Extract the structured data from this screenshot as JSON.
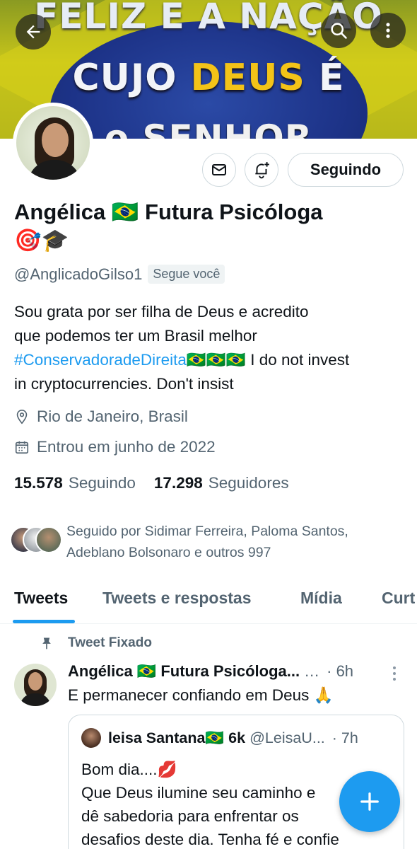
{
  "banner": {
    "line1": "FELIZ E A NAÇÃO",
    "line2_a": "CUJO",
    "line2_b": "DEUS",
    "line2_c": "É",
    "line3": "o SENHOR"
  },
  "profile": {
    "name_line1": "Angélica 🇧🇷 Futura Psicóloga",
    "name_line2": "🎯🎓",
    "handle": "@AnglicadoGilso1",
    "follows_you": "Segue você",
    "follow_button": "Seguindo",
    "bio_line1": "Sou grata por ser filha de Deus e acredito",
    "bio_line2": "que podemos ter um Brasil melhor",
    "bio_hashtag": "#ConservadoradeDireita",
    "bio_flags": "🇧🇷🇧🇷🇧🇷",
    "bio_rest": " I do not invest",
    "bio_line4": "in cryptocurrencies. Don't insist",
    "location": "Rio de Janeiro, Brasil",
    "joined": "Entrou em junho de 2022",
    "following_count": "15.578",
    "following_label": "Seguindo",
    "followers_count": "17.298",
    "followers_label": "Seguidores",
    "followed_by_line1": "Seguido por Sidimar Ferreira, Paloma Santos,",
    "followed_by_line2": "Adeblano Bolsonaro e outros 997"
  },
  "tabs": [
    {
      "label": "Tweets"
    },
    {
      "label": "Tweets e respostas"
    },
    {
      "label": "Mídia"
    },
    {
      "label": "Curt"
    }
  ],
  "pinned_tweet": {
    "pinned_label": "Tweet Fixado",
    "author": "Angélica 🇧🇷 Futura Psicóloga...",
    "ellipsis": "…",
    "time": "· 6h",
    "text": "E permanecer confiando em Deus 🙏",
    "quote": {
      "name": "leisa Santana🇧🇷 6k",
      "handle": "@LeisaU...",
      "time": "· 7h",
      "text": "Bom dia....💋\nQue Deus ilumine seu caminho e\ndê sabedoria para enfrentar os\ndesafios deste dia. Tenha fé e confie"
    }
  },
  "colors": {
    "accent": "#1d9bf0",
    "text_primary": "#0f1419",
    "text_secondary": "#536471",
    "border": "#cfd9de"
  }
}
